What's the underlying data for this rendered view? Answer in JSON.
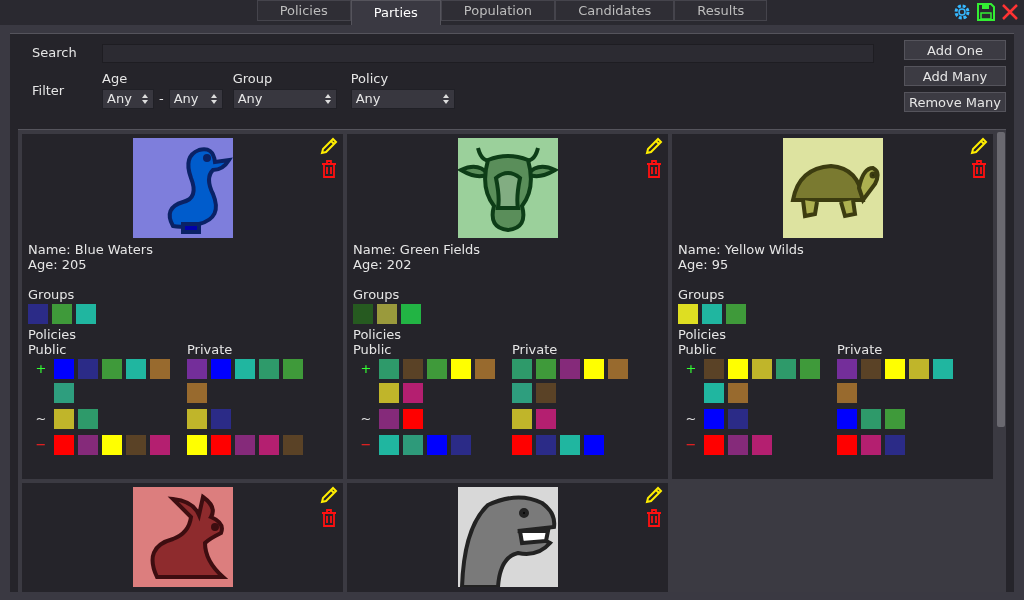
{
  "tabs": [
    {
      "label": "Policies",
      "selected": false
    },
    {
      "label": "Parties",
      "selected": true
    },
    {
      "label": "Population",
      "selected": false
    },
    {
      "label": "Candidates",
      "selected": false
    },
    {
      "label": "Results",
      "selected": false
    }
  ],
  "search": {
    "label": "Search"
  },
  "filter": {
    "label": "Filter",
    "age": {
      "label": "Age",
      "min": "Any",
      "separator": "-",
      "max": "Any"
    },
    "group": {
      "label": "Group",
      "value": "Any"
    },
    "policy": {
      "label": "Policy",
      "value": "Any"
    }
  },
  "buttons": [
    "Add One",
    "Add Many",
    "Remove Many"
  ],
  "parties": [
    {
      "emblem": {
        "kind": "duck"
      },
      "name": "Name: Blue Waters",
      "age": "Age: 205",
      "groups_label": "Groups",
      "groups": [
        {
          "color": "#2b2b87"
        },
        {
          "color": "#3f9a3a"
        },
        {
          "color": "#20b6a0"
        }
      ],
      "policies_label": "Policies",
      "public_label": "Public",
      "private_label": "Private",
      "rows": [
        {
          "kind": "plus",
          "sign": "+",
          "public": [
            {
              "color": "#0000ff"
            },
            {
              "color": "#2b2b87"
            },
            {
              "color": "#3f9a3a"
            },
            {
              "color": "#20b6a0"
            },
            {
              "color": "#986a2e"
            },
            {
              "color": "#2e9e7e"
            }
          ],
          "private": [
            {
              "color": "#742e9a"
            },
            {
              "color": "#0000ff"
            },
            {
              "color": "#20b6a0"
            },
            {
              "color": "#2e9a6a"
            },
            {
              "color": "#3f9a3a"
            },
            {
              "color": "#986a2e"
            }
          ]
        },
        {
          "kind": "neutral",
          "sign": "~",
          "public": [
            {
              "color": "#c0b52a"
            },
            {
              "color": "#2e9a6a"
            }
          ],
          "private": [
            {
              "color": "#c0b52a"
            },
            {
              "color": "#2b2b87"
            }
          ]
        },
        {
          "kind": "minus",
          "sign": "−",
          "public": [
            {
              "color": "#ff0000"
            },
            {
              "color": "#852a7a"
            },
            {
              "color": "#ffff00"
            },
            {
              "color": "#5a4226"
            },
            {
              "color": "#b41f70"
            }
          ],
          "private": [
            {
              "color": "#ffff00"
            },
            {
              "color": "#ff0000"
            },
            {
              "color": "#852a7a"
            },
            {
              "color": "#b41f70"
            },
            {
              "color": "#5a4226"
            }
          ]
        }
      ]
    },
    {
      "emblem": {
        "kind": "cow"
      },
      "name": "Name: Green Fields",
      "age": "Age: 202",
      "groups_label": "Groups",
      "groups": [
        {
          "color": "#265a20"
        },
        {
          "color": "#9a9a3c"
        },
        {
          "color": "#22b444"
        }
      ],
      "policies_label": "Policies",
      "public_label": "Public",
      "private_label": "Private",
      "rows": [
        {
          "kind": "plus",
          "sign": "+",
          "public": [
            {
              "color": "#2e9a6a"
            },
            {
              "color": "#5a4226"
            },
            {
              "color": "#3f9a3a"
            },
            {
              "color": "#ffff00"
            },
            {
              "color": "#986a2e"
            },
            {
              "color": "#c0b52a"
            },
            {
              "color": "#b41f70"
            }
          ],
          "private": [
            {
              "color": "#2e9a6a"
            },
            {
              "color": "#3f9a3a"
            },
            {
              "color": "#852a7a"
            },
            {
              "color": "#ffff00"
            },
            {
              "color": "#986a2e"
            },
            {
              "color": "#2e9e7e"
            },
            {
              "color": "#5a4226"
            }
          ]
        },
        {
          "kind": "neutral",
          "sign": "~",
          "public": [
            {
              "color": "#852a7a"
            },
            {
              "color": "#ff0000"
            }
          ],
          "private": [
            {
              "color": "#c0b52a"
            },
            {
              "color": "#b41f70"
            }
          ]
        },
        {
          "kind": "minus",
          "sign": "−",
          "public": [
            {
              "color": "#20b6a0"
            },
            {
              "color": "#2e9a7a"
            },
            {
              "color": "#0000ff"
            },
            {
              "color": "#2b2b87"
            }
          ],
          "private": [
            {
              "color": "#ff0000"
            },
            {
              "color": "#2b2b87"
            },
            {
              "color": "#20b6a0"
            },
            {
              "color": "#0000ff"
            }
          ]
        }
      ]
    },
    {
      "emblem": {
        "kind": "turtle"
      },
      "name": "Name: Yellow Wilds",
      "age": "Age: 95",
      "groups_label": "Groups",
      "groups": [
        {
          "color": "#dede22"
        },
        {
          "color": "#20b6a0"
        },
        {
          "color": "#3f9a3a"
        }
      ],
      "policies_label": "Policies",
      "public_label": "Public",
      "private_label": "Private",
      "rows": [
        {
          "kind": "plus",
          "sign": "+",
          "public": [
            {
              "color": "#5a4226"
            },
            {
              "color": "#ffff00"
            },
            {
              "color": "#c0b52a"
            },
            {
              "color": "#2e9a6a"
            },
            {
              "color": "#3f9a3a"
            },
            {
              "color": "#20b6a0"
            },
            {
              "color": "#986a2e"
            }
          ],
          "private": [
            {
              "color": "#742e9a"
            },
            {
              "color": "#5a4226"
            },
            {
              "color": "#ffff00"
            },
            {
              "color": "#c0b52a"
            },
            {
              "color": "#20b6a0"
            },
            {
              "color": "#986a2e"
            }
          ]
        },
        {
          "kind": "neutral",
          "sign": "~",
          "public": [
            {
              "color": "#0000ff"
            },
            {
              "color": "#2b2b87"
            }
          ],
          "private": [
            {
              "color": "#0000ff"
            },
            {
              "color": "#2e9a6a"
            },
            {
              "color": "#3f9a3a"
            }
          ]
        },
        {
          "kind": "minus",
          "sign": "−",
          "public": [
            {
              "color": "#ff0000"
            },
            {
              "color": "#852a7a"
            },
            {
              "color": "#b41f70"
            }
          ],
          "private": [
            {
              "color": "#ff0000"
            },
            {
              "color": "#b41f70"
            },
            {
              "color": "#2b2b87"
            }
          ]
        }
      ]
    },
    {
      "emblem": {
        "kind": "rabbit"
      }
    },
    {
      "emblem": {
        "kind": "dinosaur"
      }
    }
  ]
}
